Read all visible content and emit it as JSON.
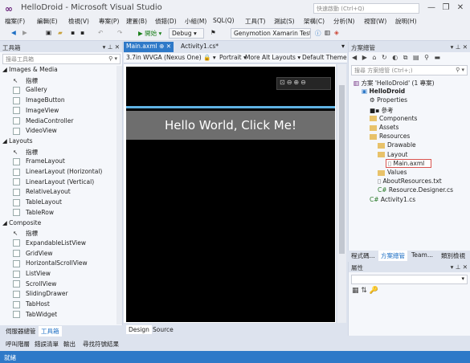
{
  "window": {
    "title": "HelloDroid - Microsoft Visual Studio",
    "quick_launch_placeholder": "快速啟動 (Ctrl+Q)",
    "minimize": "—",
    "restore": "❐",
    "close": "✕"
  },
  "menu": [
    "檔案(F)",
    "編輯(E)",
    "檢視(V)",
    "專案(P)",
    "建置(B)",
    "偵錯(D)",
    "小組(M)",
    "SQL(Q)",
    "工具(T)",
    "測試(S)",
    "架構(C)",
    "分析(N)",
    "視窗(W)",
    "說明(H)"
  ],
  "toolbar": {
    "start_label": "▶ 開始 ▾",
    "config": "Debug",
    "device": "Genymotion Xamarin Test"
  },
  "toolbox": {
    "title": "工具箱",
    "search_placeholder": "搜尋工具箱",
    "items": [
      {
        "type": "cat",
        "label": "◢ Images & Media"
      },
      {
        "type": "item",
        "label": "指標",
        "ptr": true
      },
      {
        "type": "item",
        "label": "Gallery"
      },
      {
        "type": "item",
        "label": "ImageButton"
      },
      {
        "type": "item",
        "label": "ImageView"
      },
      {
        "type": "item",
        "label": "MediaController"
      },
      {
        "type": "item",
        "label": "VideoView"
      },
      {
        "type": "cat",
        "label": "◢ Layouts"
      },
      {
        "type": "item",
        "label": "指標",
        "ptr": true
      },
      {
        "type": "item",
        "label": "FrameLayout"
      },
      {
        "type": "item",
        "label": "LinearLayout (Horizontal)"
      },
      {
        "type": "item",
        "label": "LinearLayout (Vertical)"
      },
      {
        "type": "item",
        "label": "RelativeLayout"
      },
      {
        "type": "item",
        "label": "TableLayout"
      },
      {
        "type": "item",
        "label": "TableRow"
      },
      {
        "type": "cat",
        "label": "◢ Composite"
      },
      {
        "type": "item",
        "label": "指標",
        "ptr": true
      },
      {
        "type": "item",
        "label": "ExpandableListView"
      },
      {
        "type": "item",
        "label": "GridView"
      },
      {
        "type": "item",
        "label": "HorizontalScrollView"
      },
      {
        "type": "item",
        "label": "ListView"
      },
      {
        "type": "item",
        "label": "ScrollView"
      },
      {
        "type": "item",
        "label": "SlidingDrawer"
      },
      {
        "type": "item",
        "label": "TabHost"
      },
      {
        "type": "item",
        "label": "TabWidget"
      }
    ],
    "tabs": [
      "伺服器總管",
      "工具箱"
    ]
  },
  "editor": {
    "tabs": [
      "Main.axml",
      "Activity1.cs*"
    ],
    "device_combo": "3.7in WVGA (Nexus One)",
    "orientation": "Portrait",
    "more_label": "More",
    "layouts_label": "Alt Layouts ▾",
    "theme": "Default Theme",
    "hello_text": "Hello World, Click Me!",
    "bottom_tabs": [
      "Design",
      "Source"
    ]
  },
  "solution": {
    "title": "方案總管",
    "search_placeholder": "搜尋 方案總管 (Ctrl+;)",
    "nodes": [
      {
        "d": 0,
        "label": "方案 'HelloDroid' (1 專案)",
        "k": "sol"
      },
      {
        "d": 1,
        "label": "HelloDroid",
        "k": "proj",
        "bold": true
      },
      {
        "d": 2,
        "label": "Properties",
        "k": "wrench"
      },
      {
        "d": 2,
        "label": "參考",
        "k": "ref"
      },
      {
        "d": 2,
        "label": "Components",
        "k": "folder"
      },
      {
        "d": 2,
        "label": "Assets",
        "k": "folder"
      },
      {
        "d": 2,
        "label": "Resources",
        "k": "folder"
      },
      {
        "d": 3,
        "label": "Drawable",
        "k": "folder"
      },
      {
        "d": 3,
        "label": "Layout",
        "k": "folder"
      },
      {
        "d": 4,
        "label": "Main.axml",
        "k": "file",
        "sel": true
      },
      {
        "d": 3,
        "label": "Values",
        "k": "folder"
      },
      {
        "d": 3,
        "label": "AboutResources.txt",
        "k": "file"
      },
      {
        "d": 3,
        "label": "Resource.Designer.cs",
        "k": "cs"
      },
      {
        "d": 2,
        "label": "Activity1.cs",
        "k": "cs"
      }
    ],
    "bottom_tabs": [
      "程式碼...",
      "方案總管",
      "Team...",
      "類別檢視"
    ]
  },
  "properties": {
    "title": "屬性"
  },
  "bottom_panels": [
    "呼叫階層",
    "錯誤清單",
    "輸出",
    "尋找符號結果"
  ],
  "status": {
    "text": "就緒"
  },
  "colors": {
    "accent": "#2e79c8",
    "highlight": "#d9534f",
    "device_bar": "#6e6e6e"
  }
}
